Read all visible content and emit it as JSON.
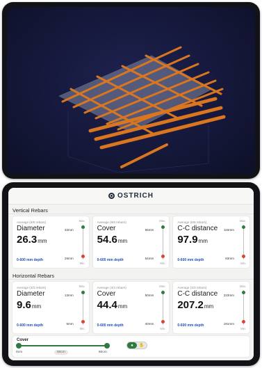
{
  "brand": {
    "name": "OSTRICH",
    "logo_icon": "ostrich-logo-icon"
  },
  "colors": {
    "accent": "#2e7a40",
    "min_dot": "#d9452f",
    "range_text": "#1e4fb8",
    "viewport_bg": "#15183a",
    "rebar": "#d9761f"
  },
  "sections": {
    "vertical": {
      "title": "Vertical Rebars",
      "cards": [
        {
          "sub": "Average (8/8 rebars)",
          "name": "Diameter",
          "value": "26.3",
          "unit": "mm",
          "range": "0-600 mm depth",
          "max_label": "Max.",
          "min_label": "Min.",
          "max_mm": "32mm",
          "min_mm": "25mm"
        },
        {
          "sub": "Average (8/8 rebars)",
          "name": "Cover",
          "value": "54.6",
          "unit": "mm",
          "range": "0-600 mm depth",
          "max_label": "Max.",
          "min_label": "Min.",
          "max_mm": "56mm",
          "min_mm": "54mm"
        },
        {
          "sub": "Average (8/8 rebars)",
          "name": "C-C distance",
          "value": "97.9",
          "unit": "mm",
          "range": "0-600 mm depth",
          "max_label": "Max.",
          "min_label": "Min.",
          "max_mm": "116mm",
          "min_mm": "83mm"
        }
      ]
    },
    "horizontal": {
      "title": "Horizontal Rebars",
      "cards": [
        {
          "sub": "Average (3/3 rebars)",
          "name": "Diameter",
          "value": "9.6",
          "unit": "mm",
          "range": "0-600 mm depth",
          "max_label": "Max.",
          "min_label": "Min.",
          "max_mm": "13mm",
          "min_mm": "5mm"
        },
        {
          "sub": "Average (3/3 rebars)",
          "name": "Cover",
          "value": "44.4",
          "unit": "mm",
          "range": "0-600 mm depth",
          "max_label": "Max.",
          "min_label": "Min.",
          "max_mm": "50mm",
          "min_mm": "40mm"
        },
        {
          "sub": "Average (3/3 rebars)",
          "name": "C-C distance",
          "value": "207.2",
          "unit": "mm",
          "range": "0-600 mm depth",
          "max_label": "Max.",
          "min_label": "Min.",
          "max_mm": "223mm",
          "min_mm": "191mm"
        }
      ]
    }
  },
  "cover_filter": {
    "label": "Cover",
    "min": "0cm",
    "current": "60cm",
    "max": "60cm",
    "toggle_left_icon": "rebar-view-icon",
    "toggle_right_icon": "hand-icon",
    "toggle_selected": "left"
  }
}
